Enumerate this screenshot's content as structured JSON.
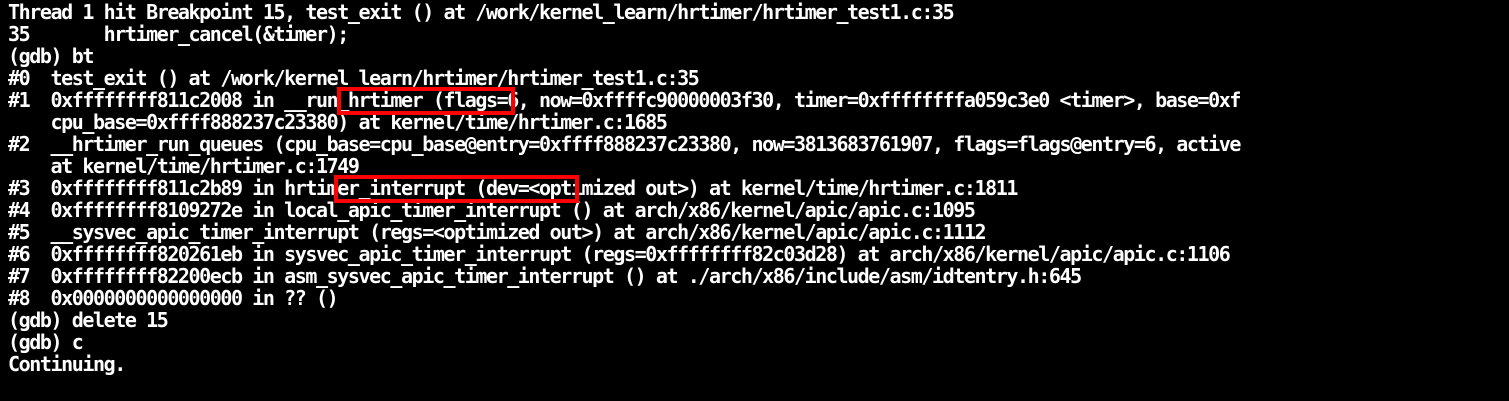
{
  "terminal": {
    "lines": [
      "Thread 1 hit Breakpoint 15, test_exit () at /work/kernel_learn/hrtimer/hrtimer_test1.c:35",
      "35       hrtimer_cancel(&timer);",
      "(gdb) bt",
      "#0  test_exit () at /work/kernel_learn/hrtimer/hrtimer_test1.c:35",
      "#1  0xffffffff811c2008 in __run_hrtimer (flags=6, now=0xffffc90000003f30, timer=0xffffffffa059c3e0 <timer>, base=0xf",
      "    cpu_base=0xffff888237c23380) at kernel/time/hrtimer.c:1685",
      "#2  __hrtimer_run_queues (cpu_base=cpu_base@entry=0xffff888237c23380, now=3813683761907, flags=flags@entry=6, active",
      "    at kernel/time/hrtimer.c:1749",
      "#3  0xffffffff811c2b89 in hrtimer_interrupt (dev=<optimized out>) at kernel/time/hrtimer.c:1811",
      "#4  0xffffffff8109272e in local_apic_timer_interrupt () at arch/x86/kernel/apic/apic.c:1095",
      "#5  __sysvec_apic_timer_interrupt (regs=<optimized out>) at arch/x86/kernel/apic/apic.c:1112",
      "#6  0xffffffff820261eb in sysvec_apic_timer_interrupt (regs=0xffffffff82c03d28) at arch/x86/kernel/apic/apic.c:1106",
      "#7  0xffffffff82200ecb in asm_sysvec_apic_timer_interrupt () at ./arch/x86/include/asm/idtentry.h:645",
      "#8  0x0000000000000000 in ?? ()",
      "(gdb) delete 15",
      "(gdb) c",
      "Continuing."
    ]
  },
  "colors": {
    "background": "#000000",
    "text": "#ffffff",
    "highlight": "#ff0000"
  }
}
